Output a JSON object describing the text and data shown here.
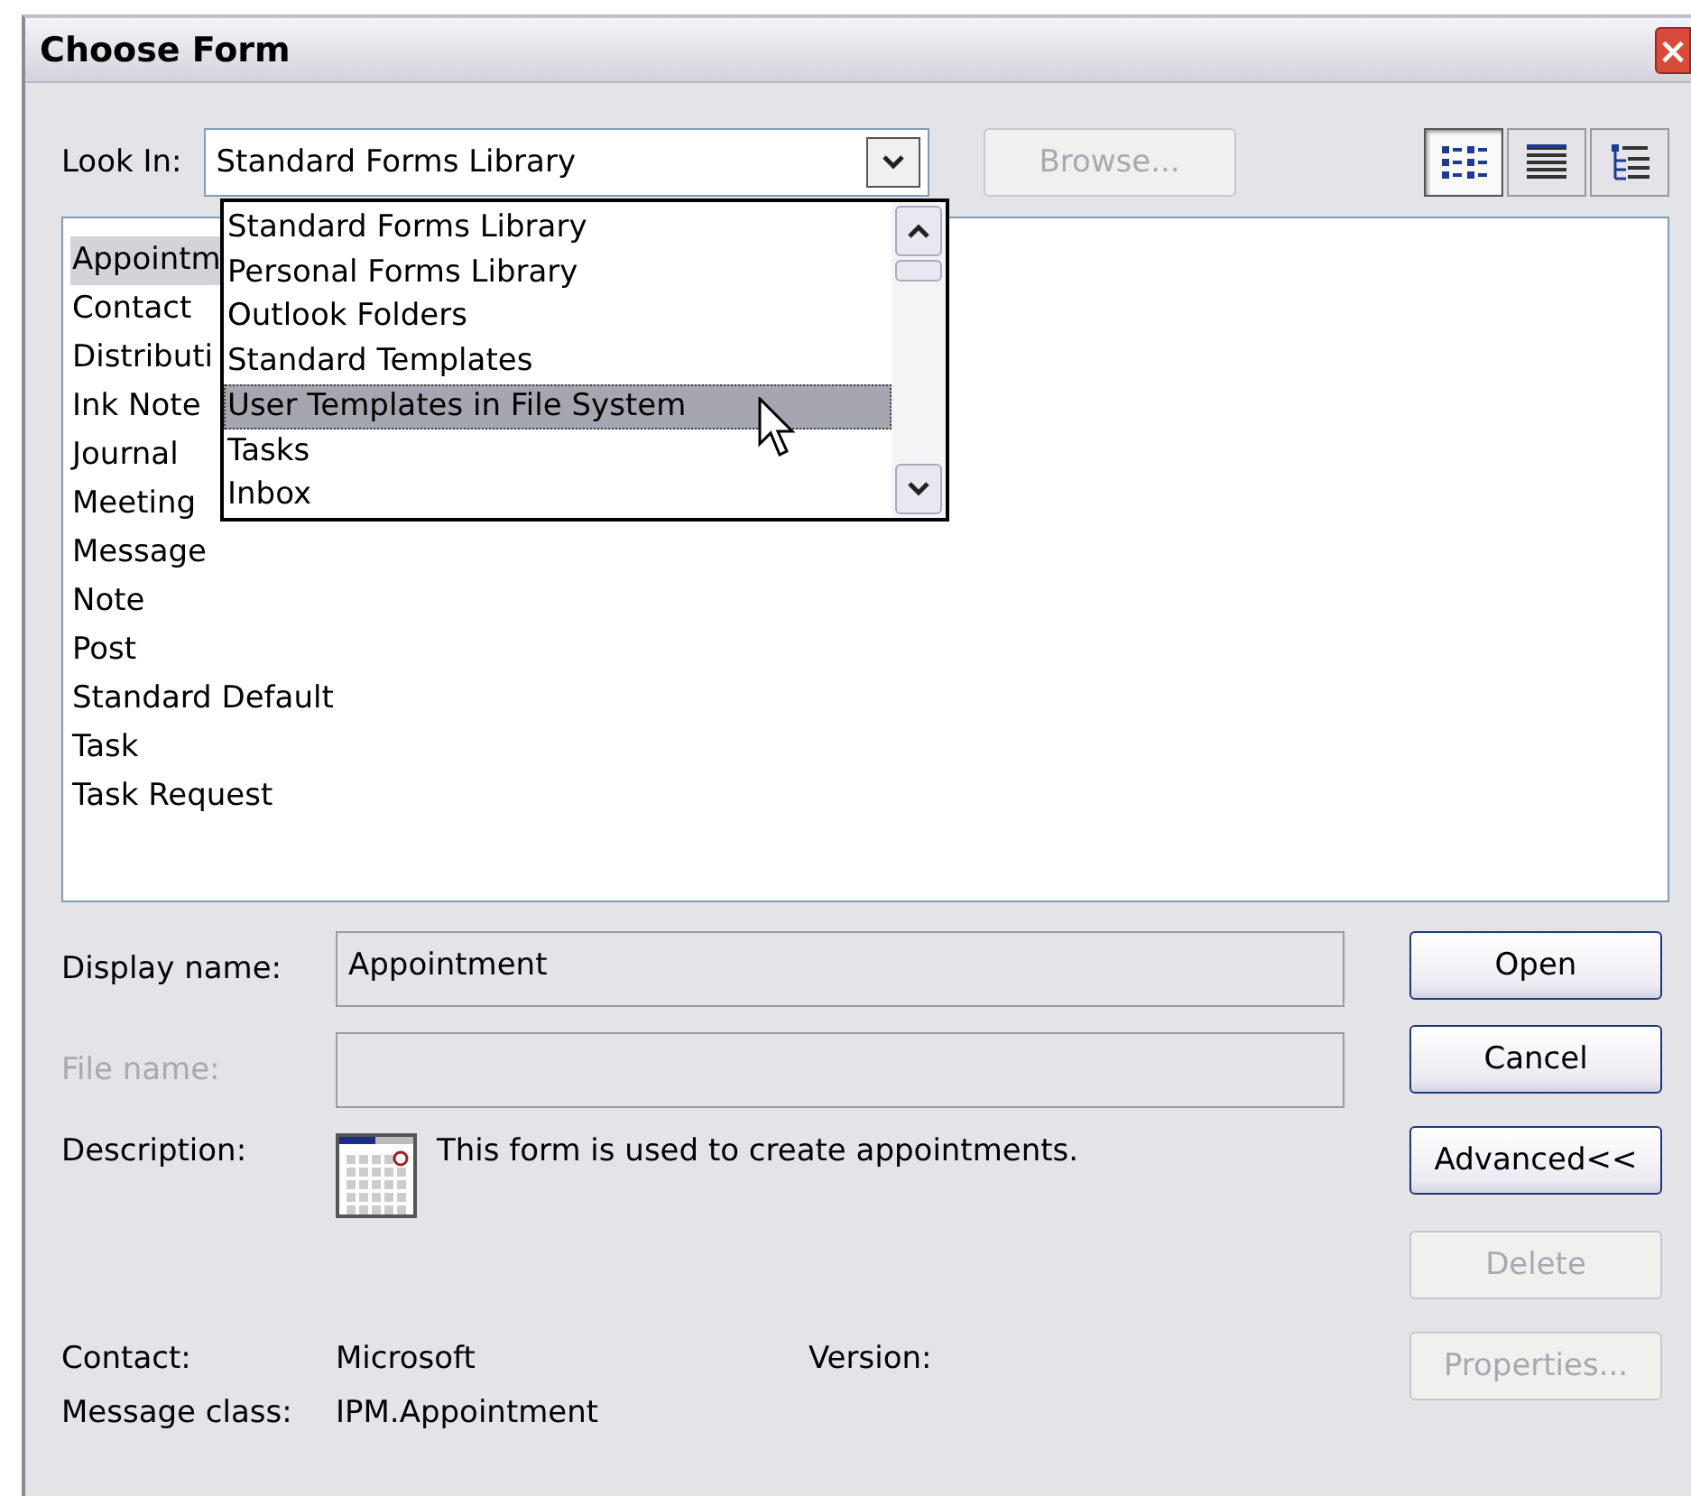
{
  "window": {
    "title": "Choose Form",
    "close": "×"
  },
  "look_in": {
    "label": "Look In:",
    "value": "Standard Forms Library",
    "browse": {
      "label": "Browse...",
      "disabled": true
    }
  },
  "view_buttons": [
    {
      "kind": "large",
      "selected": true
    },
    {
      "kind": "details",
      "selected": false
    },
    {
      "kind": "tree",
      "selected": false
    }
  ],
  "dropdown": {
    "expanded": true,
    "options": [
      {
        "label": "Standard Forms Library",
        "selected": false
      },
      {
        "label": "Personal Forms Library",
        "selected": false
      },
      {
        "label": "Outlook Folders",
        "selected": false
      },
      {
        "label": "Standard Templates",
        "selected": false
      },
      {
        "label": "User Templates in File System",
        "selected": true
      },
      {
        "label": "Tasks",
        "selected": false
      },
      {
        "label": "Inbox",
        "selected": false
      }
    ]
  },
  "forms": [
    {
      "label": "Appointm",
      "selected": true
    },
    {
      "label": "Contact",
      "selected": false
    },
    {
      "label": "Distributi",
      "selected": false
    },
    {
      "label": "Ink Note",
      "selected": false
    },
    {
      "label": "Journal",
      "selected": false
    },
    {
      "label": "Meeting",
      "selected": false
    },
    {
      "label": "Message",
      "selected": false
    },
    {
      "label": "Note",
      "selected": false
    },
    {
      "label": "Post",
      "selected": false
    },
    {
      "label": "Standard Default",
      "selected": false
    },
    {
      "label": "Task",
      "selected": false
    },
    {
      "label": "Task Request",
      "selected": false
    }
  ],
  "fields": [
    {
      "label": "Display name:",
      "value": "Appointment",
      "disabled": false
    },
    {
      "label": "File name:",
      "disabled": true
    }
  ],
  "description": {
    "label": "Description:",
    "text": "This form is used to create appointments."
  },
  "info": [
    {
      "label": "Contact:",
      "value": "Microsoft",
      "extra_label": "Version:"
    },
    {
      "label": "Message class:",
      "value": "IPM.Appointment"
    }
  ],
  "buttons": [
    {
      "label": "Open",
      "disabled": false
    },
    {
      "label": "Cancel",
      "disabled": false
    },
    {
      "label": "Advanced<<",
      "disabled": false
    },
    {
      "label": "Delete",
      "disabled": true
    },
    {
      "label": "Properties...",
      "disabled": true
    }
  ]
}
